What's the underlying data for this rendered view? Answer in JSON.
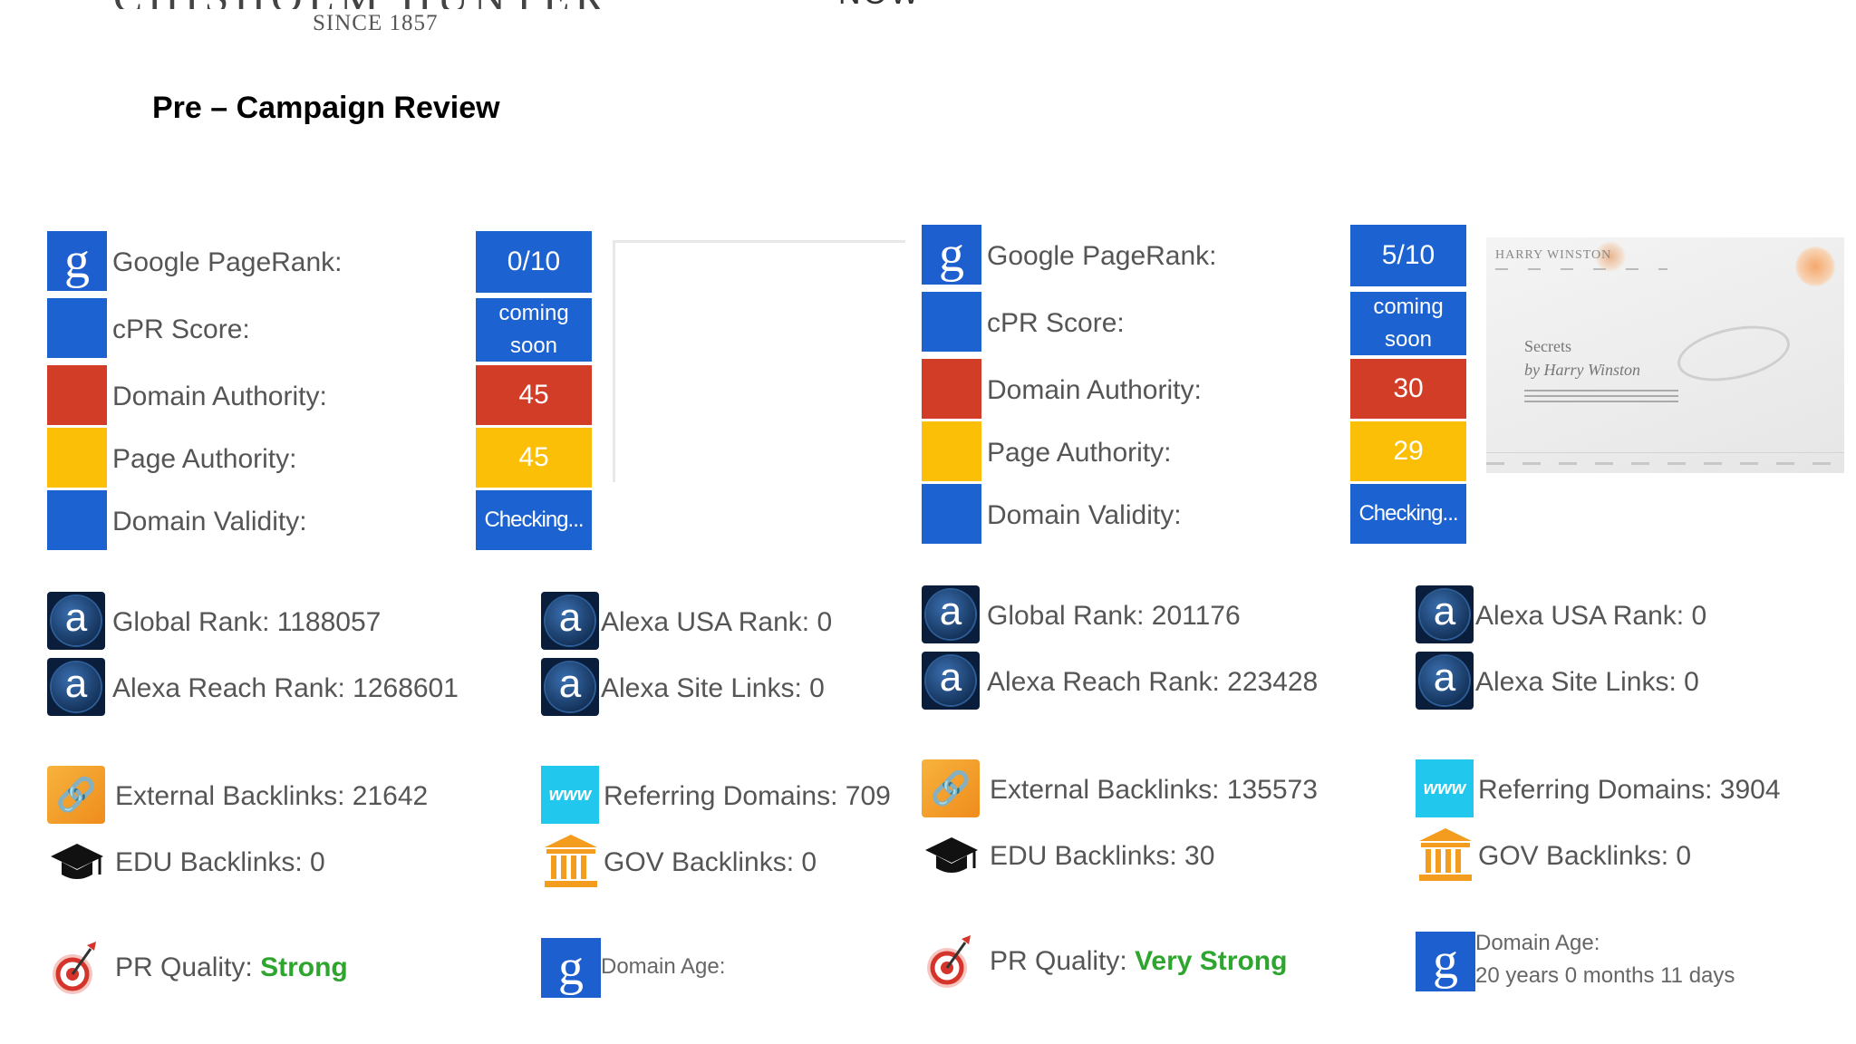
{
  "header": {
    "logo_text": "CHISHOLM HUNTER",
    "since": "SINCE 1857",
    "right_text": "NOW",
    "page_title": "Pre – Campaign Review"
  },
  "panels": [
    {
      "metrics": {
        "pagerank_label": "Google PageRank:",
        "pagerank_value": "0/10",
        "cpr_label": "cPR Score:",
        "cpr_value_line1": "coming",
        "cpr_value_line2": "soon",
        "da_label": "Domain Authority:",
        "da_value": "45",
        "pa_label": "Page Authority:",
        "pa_value": "45",
        "dv_label": "Domain Validity:",
        "dv_value": "Checking..."
      },
      "alexa": {
        "global_rank": "Global Rank: 1188057",
        "reach_rank": "Alexa Reach Rank: 1268601",
        "usa_rank": "Alexa USA Rank: 0",
        "site_links": "Alexa Site Links: 0"
      },
      "links": {
        "external": "External Backlinks: 21642",
        "referring": "Referring Domains: 709",
        "edu": "EDU Backlinks: 0",
        "gov": "GOV Backlinks: 0"
      },
      "quality": {
        "pr_label": "PR Quality: ",
        "pr_value": "Strong",
        "age_label": "Domain Age:",
        "age_value": ""
      }
    },
    {
      "metrics": {
        "pagerank_label": "Google PageRank:",
        "pagerank_value": "5/10",
        "cpr_label": "cPR Score:",
        "cpr_value_line1": "coming",
        "cpr_value_line2": "soon",
        "da_label": "Domain Authority:",
        "da_value": "30",
        "pa_label": "Page Authority:",
        "pa_value": "29",
        "dv_label": "Domain Validity:",
        "dv_value": "Checking..."
      },
      "alexa": {
        "global_rank": "Global Rank: 201176",
        "reach_rank": "Alexa Reach Rank: 223428",
        "usa_rank": "Alexa USA Rank: 0",
        "site_links": "Alexa Site Links: 0"
      },
      "links": {
        "external": "External Backlinks: 135573",
        "referring": "Referring Domains: 3904",
        "edu": "EDU Backlinks: 30",
        "gov": "GOV Backlinks: 0"
      },
      "quality": {
        "pr_label": "PR Quality: ",
        "pr_value": "Very Strong",
        "age_label": "Domain Age:",
        "age_value": "20 years 0 months 11 days"
      }
    }
  ],
  "thumbnail": {
    "brand": "HARRY WINSTON",
    "line1": "Secrets",
    "line2": "by Harry Winston"
  },
  "colors": {
    "google_blue": "#1c62d1",
    "moz_red": "#d13d26",
    "moz_yellow": "#fcbf07",
    "quality_green": "#2ea52e"
  },
  "icons": [
    "google-icon",
    "alexa-icon",
    "link-icon",
    "www-icon",
    "graduation-cap-icon",
    "gov-building-icon",
    "target-icon"
  ]
}
